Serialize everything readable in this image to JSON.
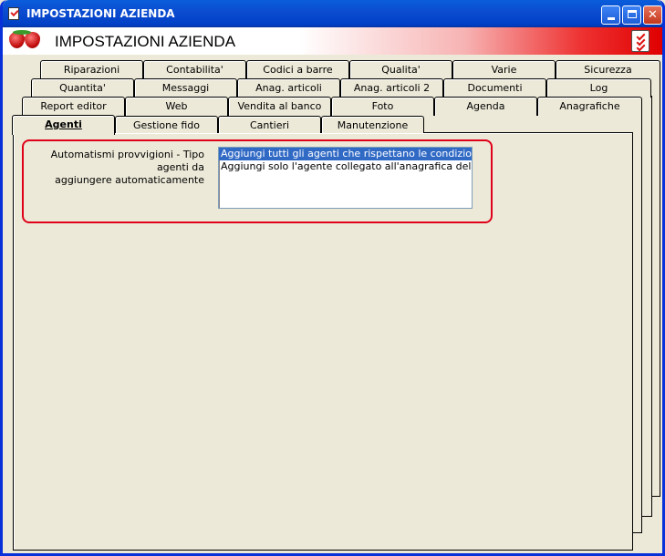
{
  "window": {
    "title": "IMPOSTAZIONI AZIENDA",
    "minimize_label": "",
    "maximize_label": "",
    "close_label": "✕"
  },
  "header": {
    "title": "IMPOSTAZIONI AZIENDA"
  },
  "tabs": {
    "row1": [
      "Riparazioni",
      "Contabilita'",
      "Codici a barre",
      "Qualita'",
      "Varie",
      "Sicurezza"
    ],
    "row2": [
      "Quantita'",
      "Messaggi",
      "Anag. articoli",
      "Anag. articoli 2",
      "Documenti",
      "Log"
    ],
    "row3": [
      "Report editor",
      "Web",
      "Vendita al banco",
      "Foto",
      "Agenda",
      "Anagrafiche"
    ],
    "row4": [
      "Agenti",
      "Gestione fido",
      "Cantieri",
      "Manutenzione"
    ],
    "active": "Agenti"
  },
  "agenti": {
    "field_label_line1": "Automatismi provvigioni - Tipo agenti da",
    "field_label_line2": "aggiungere automaticamente",
    "options": [
      "Aggiungi tutti gli agenti che rispettano le condizioni",
      "Aggiungi solo l'agente collegato all'anagrafica dell'intestatario"
    ],
    "selected_index": 0
  },
  "colors": {
    "title_bar": "#0A5DDB",
    "highlight_frame": "#E0001A",
    "selection": "#316AC5",
    "face": "#ECE9D8"
  }
}
